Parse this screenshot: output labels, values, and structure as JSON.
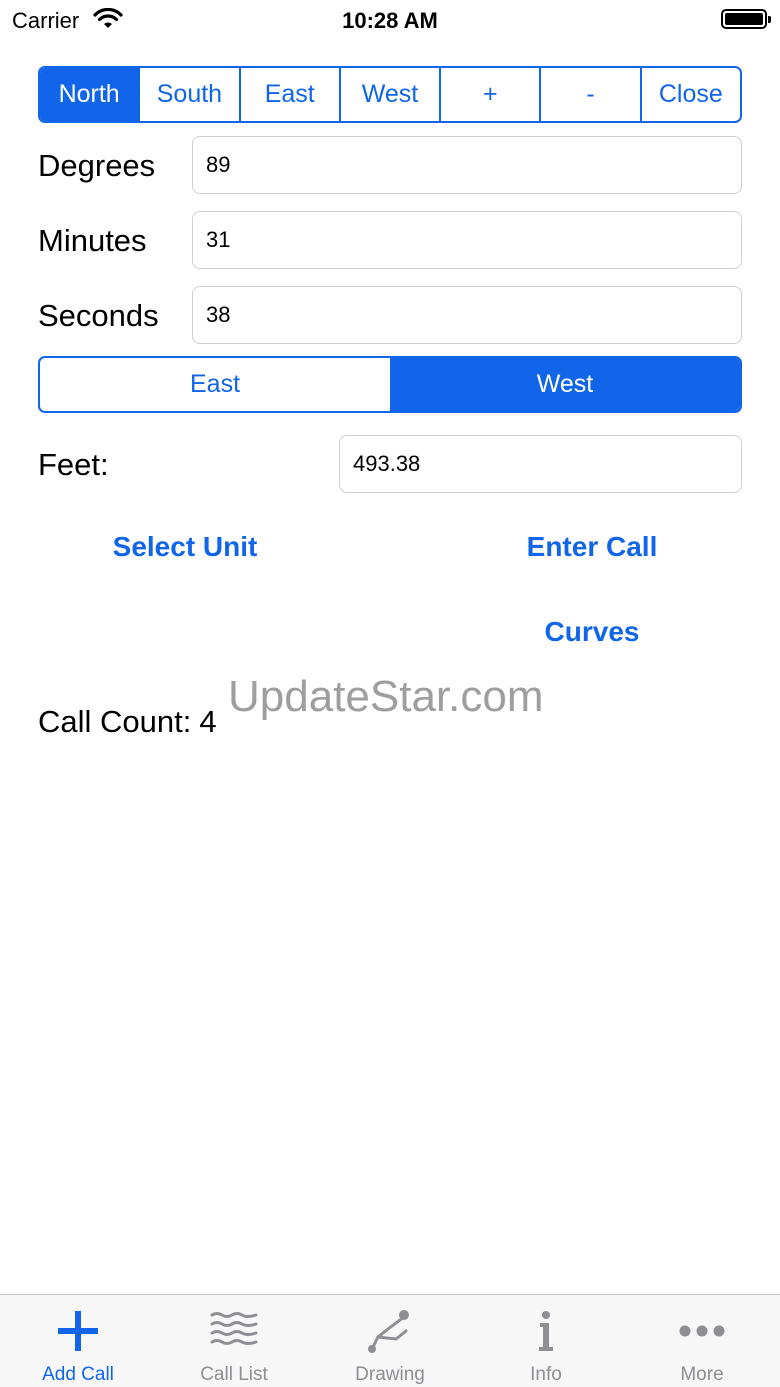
{
  "status_bar": {
    "carrier": "Carrier",
    "time": "10:28 AM"
  },
  "direction_segments": [
    {
      "label": "North",
      "selected": true
    },
    {
      "label": "South",
      "selected": false
    },
    {
      "label": "East",
      "selected": false
    },
    {
      "label": "West",
      "selected": false
    },
    {
      "label": "+",
      "selected": false
    },
    {
      "label": "-",
      "selected": false
    },
    {
      "label": "Close",
      "selected": false
    }
  ],
  "fields": {
    "degrees_label": "Degrees",
    "degrees_value": "89",
    "minutes_label": "Minutes",
    "minutes_value": "31",
    "seconds_label": "Seconds",
    "seconds_value": "38",
    "feet_label": "Feet:",
    "feet_value": "493.38"
  },
  "ew_segments": [
    {
      "label": "East",
      "selected": false
    },
    {
      "label": "West",
      "selected": true
    }
  ],
  "actions": {
    "select_unit": "Select Unit",
    "enter_call": "Enter Call",
    "curves": "Curves"
  },
  "watermark": "UpdateStar.com",
  "call_count": {
    "label": "Call Count:",
    "value": "4"
  },
  "tabs": [
    {
      "label": "Add Call",
      "icon": "plus-icon",
      "active": true
    },
    {
      "label": "Call List",
      "icon": "list-lines-icon",
      "active": false
    },
    {
      "label": "Drawing",
      "icon": "drawing-icon",
      "active": false
    },
    {
      "label": "Info",
      "icon": "info-icon",
      "active": false
    },
    {
      "label": "More",
      "icon": "more-dots-icon",
      "active": false
    }
  ],
  "colors": {
    "accent": "#1165e8",
    "inactive_tab": "#8e8e93"
  }
}
